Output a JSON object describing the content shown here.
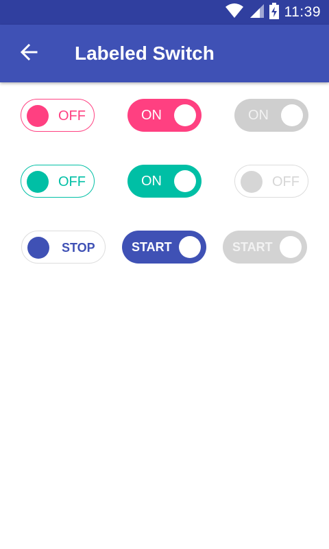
{
  "status_bar": {
    "time": "11:39",
    "icons": [
      "wifi-icon",
      "signal-icon",
      "battery-charging-icon"
    ]
  },
  "app_bar": {
    "title": "Labeled Switch",
    "back_icon": "arrow-left-icon"
  },
  "switches": [
    {
      "row": 1,
      "label": "OFF",
      "checked": false,
      "enabled": true,
      "color": "#ff4081"
    },
    {
      "row": 1,
      "label": "ON",
      "checked": true,
      "enabled": true,
      "color": "#ff4081"
    },
    {
      "row": 1,
      "label": "ON",
      "checked": true,
      "enabled": false,
      "color": "#cfcfcf"
    },
    {
      "row": 2,
      "label": "OFF",
      "checked": false,
      "enabled": true,
      "color": "#00bfa5"
    },
    {
      "row": 2,
      "label": "ON",
      "checked": true,
      "enabled": true,
      "color": "#00bfa5"
    },
    {
      "row": 2,
      "label": "OFF",
      "checked": false,
      "enabled": false,
      "color": "#d6d6d6"
    },
    {
      "row": 3,
      "label": "STOP",
      "checked": false,
      "enabled": true,
      "color": "#3f51b5"
    },
    {
      "row": 3,
      "label": "START",
      "checked": true,
      "enabled": true,
      "color": "#3f51b5"
    },
    {
      "row": 3,
      "label": "START",
      "checked": true,
      "enabled": false,
      "color": "#d3d3d3"
    }
  ],
  "colors": {
    "status_bar": "#303f9f",
    "app_bar": "#3f51b5",
    "pink_accent": "#ff4081",
    "teal_accent": "#00bfa5",
    "indigo_accent": "#3f51b5"
  }
}
